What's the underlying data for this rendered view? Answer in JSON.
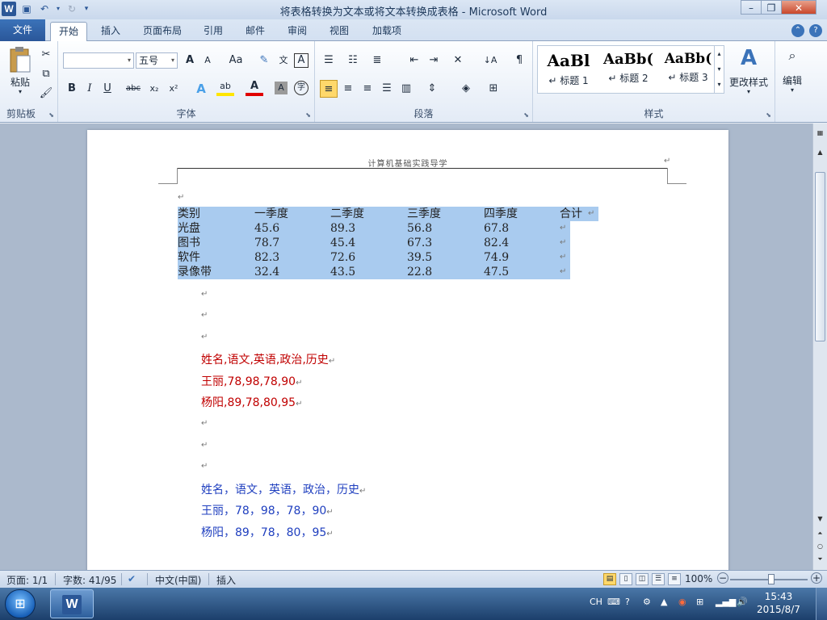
{
  "window": {
    "title": "将表格转换为文本或将文本转换成表格 - Microsoft Word",
    "app_icon": "W",
    "minimize": "–",
    "maximize": "❐",
    "close": "✕"
  },
  "tabs": [
    {
      "label": "文件"
    },
    {
      "label": "开始"
    },
    {
      "label": "插入"
    },
    {
      "label": "页面布局"
    },
    {
      "label": "引用"
    },
    {
      "label": "邮件"
    },
    {
      "label": "审阅"
    },
    {
      "label": "视图"
    },
    {
      "label": "加载项"
    }
  ],
  "ribbon": {
    "clipboard": {
      "group_label": "剪贴板",
      "paste_label": "粘贴"
    },
    "font": {
      "group_label": "字体",
      "font_name": "",
      "font_size": "五号",
      "bold": "B",
      "italic": "I",
      "underline": "U",
      "strike": "abc",
      "subscript": "x₂",
      "superscript": "x²",
      "grow": "A",
      "shrink": "A",
      "change_case": "Aa",
      "highlight": "ab",
      "font_color": "A",
      "char_shading": "A",
      "enclose": "字"
    },
    "paragraph": {
      "group_label": "段落"
    },
    "styles": {
      "group_label": "样式",
      "items": [
        {
          "preview": "AaBl",
          "label": "↵ 标题 1"
        },
        {
          "preview": "AaBb(",
          "label": "↵ 标题 2"
        },
        {
          "preview": "AaBb(",
          "label": "↵ 标题 3"
        }
      ],
      "change_styles": "更改样式"
    },
    "editing": {
      "label": "编辑"
    }
  },
  "document": {
    "header": "计算机基础实践导学",
    "table": {
      "rows": [
        [
          "类别",
          "一季度",
          "二季度",
          "三季度",
          "四季度",
          "合计"
        ],
        [
          "光盘",
          "45.6",
          "89.3",
          "56.8",
          "67.8",
          ""
        ],
        [
          "图书",
          "78.7",
          "45.4",
          "67.3",
          "82.4",
          ""
        ],
        [
          "软件",
          "82.3",
          "72.6",
          "39.5",
          "74.9",
          ""
        ],
        [
          "录像带",
          "32.4",
          "43.5",
          "22.8",
          "47.5",
          ""
        ]
      ]
    },
    "red_lines": [
      "姓名,语文,英语,政治,历史",
      "王丽,78,98,78,90",
      "杨阳,89,78,80,95"
    ],
    "blue_lines": [
      "姓名，语文，英语，政治，历史",
      "王丽，78，98，78，90",
      "杨阳，89，78，80，95"
    ],
    "para_mark": "↵",
    "colors": {
      "red_text": "#c00000",
      "blue_text": "#1f3fbf",
      "selection": "#a9cbef"
    }
  },
  "statusbar": {
    "page": "页面: 1/1",
    "words": "字数: 41/95",
    "language": "中文(中国)",
    "mode": "插入",
    "zoom": "100%",
    "zoom_minus": "−",
    "zoom_plus": "+"
  },
  "taskbar": {
    "tray_lang": "CH",
    "time": "15:43",
    "date": "2015/8/7"
  }
}
